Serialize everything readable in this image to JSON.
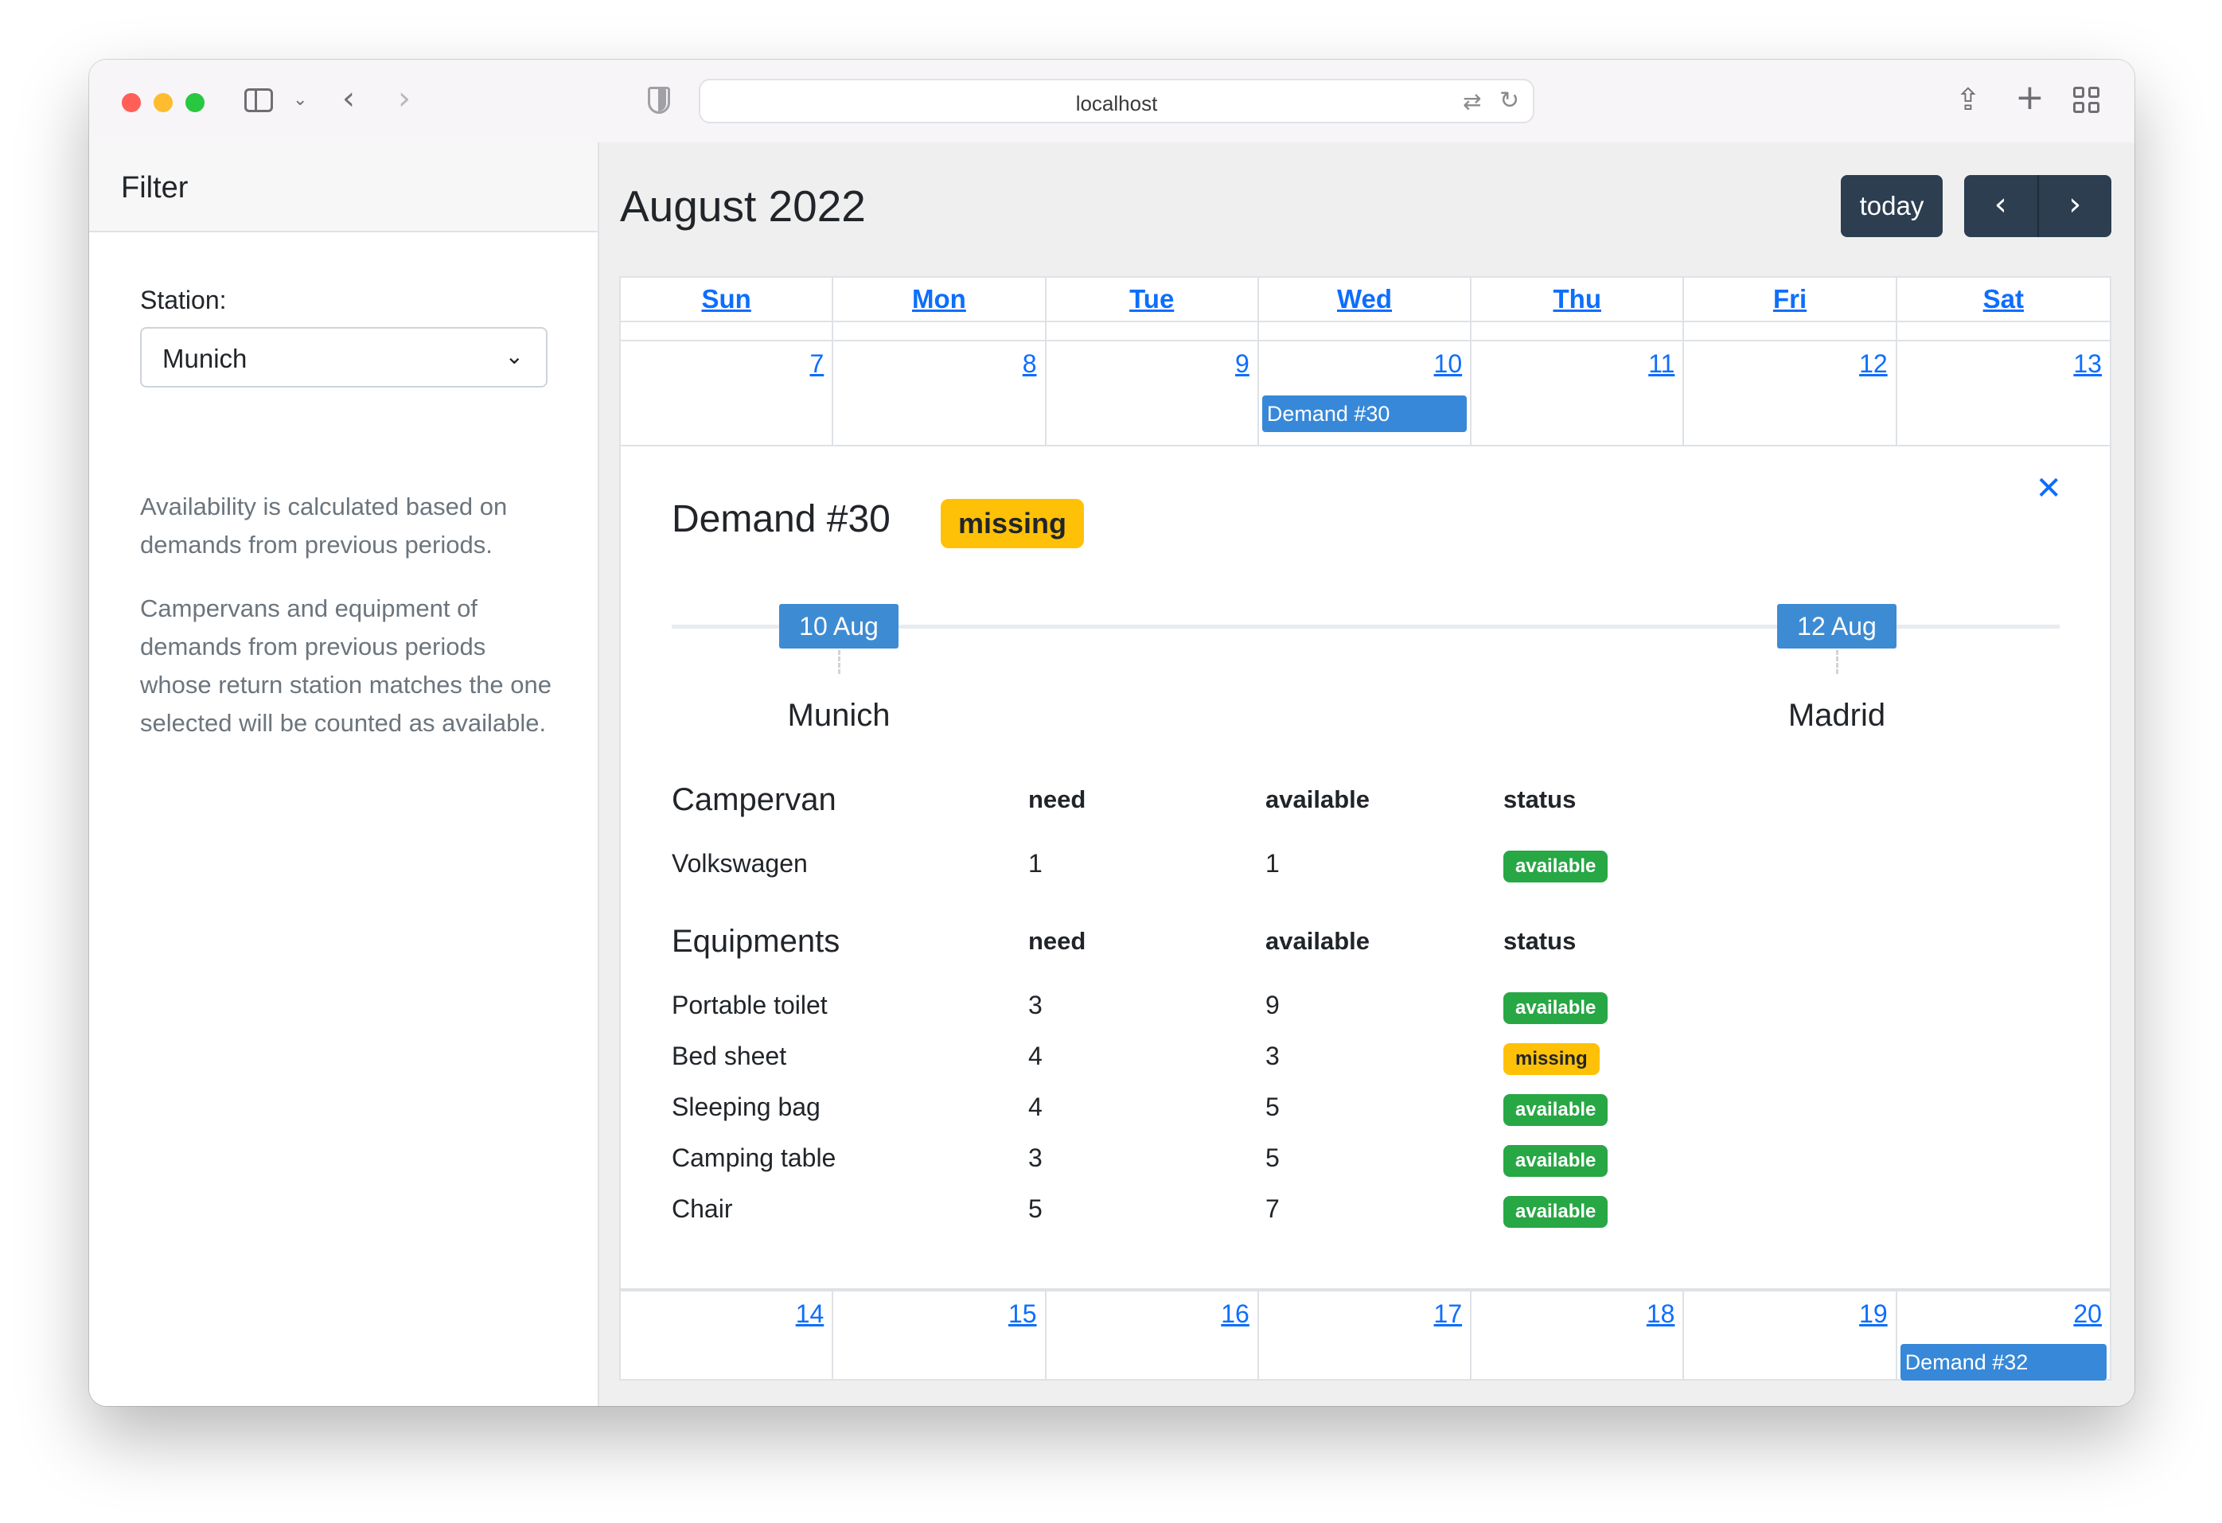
{
  "browser": {
    "url": "localhost"
  },
  "sidebar": {
    "title": "Filter",
    "station_label": "Station:",
    "station_value": "Munich",
    "help_text_1": "Availability is calculated based on demands from previous periods.",
    "help_text_2": "Campervans and equipment of demands from previous periods whose return station matches the one selected will be counted as available."
  },
  "calendar": {
    "title": "August 2022",
    "today_label": "today",
    "weekdays": [
      "Sun",
      "Mon",
      "Tue",
      "Wed",
      "Thu",
      "Fri",
      "Sat"
    ],
    "week1_days": [
      "7",
      "8",
      "9",
      "10",
      "11",
      "12",
      "13"
    ],
    "week2_days": [
      "14",
      "15",
      "16",
      "17",
      "18",
      "19",
      "20"
    ],
    "event_week1": "Demand #30",
    "event_week2": "Demand #32"
  },
  "detail": {
    "title": "Demand #30",
    "status": "missing",
    "start_date": "10 Aug",
    "end_date": "12 Aug",
    "start_station": "Munich",
    "end_station": "Madrid",
    "campervan": {
      "heading": "Campervan",
      "col_need": "need",
      "col_available": "available",
      "col_status": "status",
      "rows": [
        {
          "name": "Volkswagen",
          "need": "1",
          "available": "1",
          "status": "available"
        }
      ]
    },
    "equipments": {
      "heading": "Equipments",
      "col_need": "need",
      "col_available": "available",
      "col_status": "status",
      "rows": [
        {
          "name": "Portable toilet",
          "need": "3",
          "available": "9",
          "status": "available"
        },
        {
          "name": "Bed sheet",
          "need": "4",
          "available": "3",
          "status": "missing"
        },
        {
          "name": "Sleeping bag",
          "need": "4",
          "available": "5",
          "status": "available"
        },
        {
          "name": "Camping table",
          "need": "3",
          "available": "5",
          "status": "available"
        },
        {
          "name": "Chair",
          "need": "5",
          "available": "7",
          "status": "available"
        }
      ]
    }
  },
  "colors": {
    "primary_link": "#0d6efd",
    "event_blue": "#3788d8",
    "available_green": "#28a745",
    "missing_yellow": "#ffc107",
    "button_dark": "#2c3e50"
  }
}
